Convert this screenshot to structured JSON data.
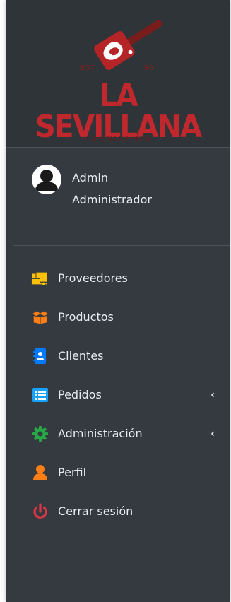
{
  "brand": {
    "est_left": "EST",
    "est_right": "90",
    "title": "LA SEVILLANA",
    "subtitle": "CARNICERIA"
  },
  "user": {
    "name": "Admin",
    "role": "Administrador"
  },
  "nav": [
    {
      "label": "Proveedores",
      "icon": "truck-loading-icon",
      "color": "#ffc107",
      "has_submenu": false
    },
    {
      "label": "Productos",
      "icon": "box-open-icon",
      "color": "#fd7e14",
      "has_submenu": false
    },
    {
      "label": "Clientes",
      "icon": "address-book-icon",
      "color": "#007bff",
      "has_submenu": false
    },
    {
      "label": "Pedidos",
      "icon": "list-alt-icon",
      "color": "#17a2ff",
      "has_submenu": true,
      "chevron": "‹"
    },
    {
      "label": "Administración",
      "icon": "cog-icon",
      "color": "#28a745",
      "has_submenu": true,
      "chevron": "‹"
    },
    {
      "label": "Perfil",
      "icon": "user-icon",
      "color": "#fd7e14",
      "has_submenu": false
    },
    {
      "label": "Cerrar sesión",
      "icon": "power-off-icon",
      "color": "#dc3545",
      "has_submenu": false
    }
  ],
  "colors": {
    "sidebar_bg": "#343a40",
    "brand_red": "#c0282d",
    "text": "#e9ecef"
  }
}
